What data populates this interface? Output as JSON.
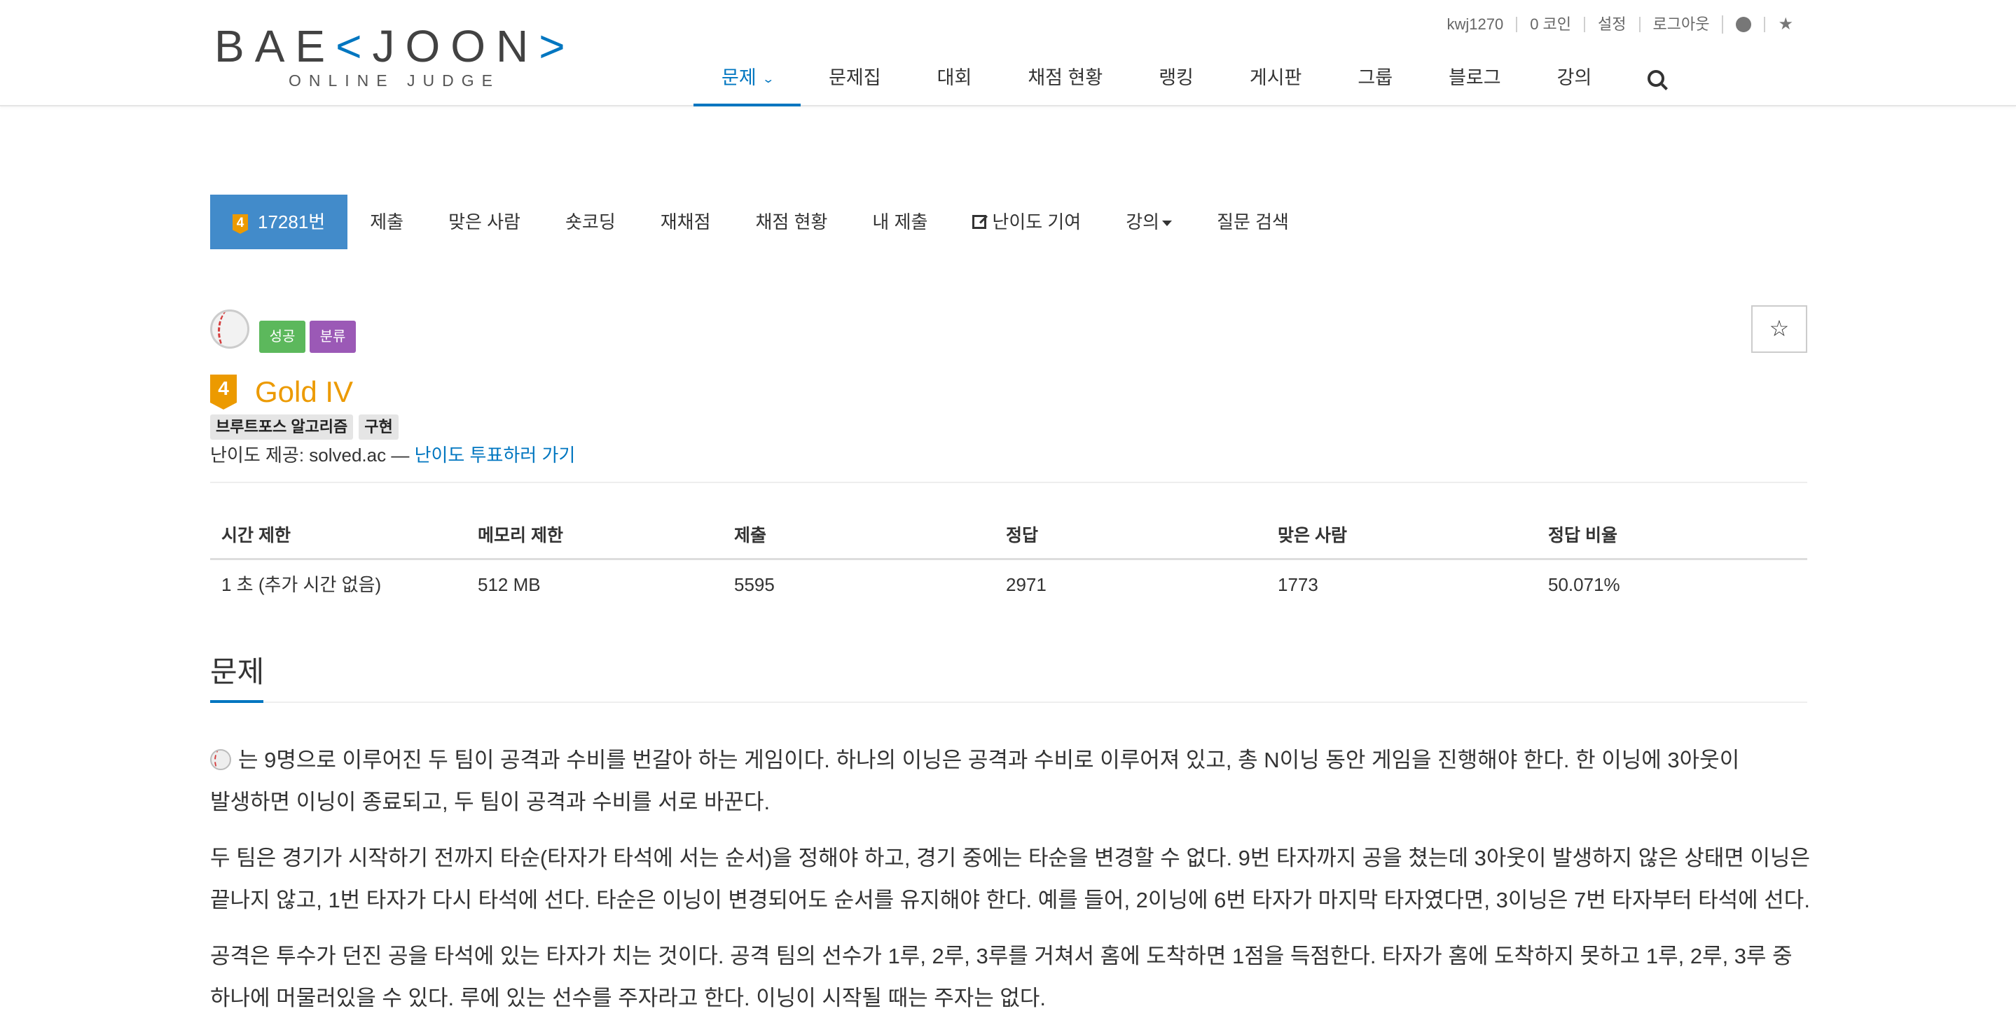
{
  "header": {
    "logo_main_left": "BAE",
    "logo_bracket_left": "<",
    "logo_main_right": "JOON",
    "logo_bracket_right": ">",
    "logo_sub": "ONLINE JUDGE",
    "top_menu": {
      "username": "kwj1270",
      "coins": "0 코인",
      "settings": "설정",
      "logout": "로그아웃"
    },
    "nav": {
      "problems": "문제",
      "workbook": "문제집",
      "contest": "대회",
      "status": "채점 현황",
      "ranking": "랭킹",
      "board": "게시판",
      "group": "그룹",
      "blog": "블로그",
      "lecture": "강의"
    }
  },
  "problem_menu": {
    "tier_digit": "4",
    "problem_number": "17281번",
    "submit": "제출",
    "accepted_users": "맞은 사람",
    "shortcoding": "숏코딩",
    "rejudge": "재채점",
    "status": "채점 현황",
    "my_submissions": "내 제출",
    "contribute_tier": "난이도 기여",
    "lecture": "강의",
    "question_search": "질문 검색"
  },
  "labels": {
    "success": "성공",
    "classification": "분류"
  },
  "fav_star": "☆",
  "tier": {
    "digit": "4",
    "name": "Gold IV",
    "color": "#ec9a00"
  },
  "tags": [
    "브루트포스 알고리즘",
    "구현"
  ],
  "tier_source": {
    "prefix": "난이도 제공: solved.ac — ",
    "link": "난이도 투표하러 가기"
  },
  "info_table": {
    "headers": [
      "시간 제한",
      "메모리 제한",
      "제출",
      "정답",
      "맞은 사람",
      "정답 비율"
    ],
    "values": [
      "1 초 (추가 시간 없음)",
      "512 MB",
      "5595",
      "2971",
      "1773",
      "50.071%"
    ]
  },
  "section": {
    "title": "문제"
  },
  "description": {
    "p1": "는 9명으로 이루어진 두 팀이 공격과 수비를 번갈아 하는 게임이다. 하나의 이닝은 공격과 수비로 이루어져 있고, 총 N이닝 동안 게임을 진행해야 한다. 한 이닝에 3아웃이 발생하면 이닝이 종료되고, 두 팀이 공격과 수비를 서로 바꾼다.",
    "p2": "두 팀은 경기가 시작하기 전까지 타순(타자가 타석에 서는 순서)을 정해야 하고, 경기 중에는 타순을 변경할 수 없다. 9번 타자까지 공을 쳤는데 3아웃이 발생하지 않은 상태면 이닝은 끝나지 않고, 1번 타자가 다시 타석에 선다. 타순은 이닝이 변경되어도 순서를 유지해야 한다. 예를 들어, 2이닝에 6번 타자가 마지막 타자였다면, 3이닝은 7번 타자부터 타석에 선다.",
    "p3": "공격은 투수가 던진 공을 타석에 있는 타자가 치는 것이다. 공격 팀의 선수가 1루, 2루, 3루를 거쳐서 홈에 도착하면 1점을 득점한다. 타자가 홈에 도착하지 못하고 1루, 2루, 3루 중 하나에 머물러있을 수 있다. 루에 있는 선수를 주자라고 한다. 이닝이 시작될 때는 주자는 없다."
  },
  "colors": {
    "accent": "#0076c0",
    "problem_tab_bg": "#428bca",
    "success": "#5cb85c",
    "classification": "#9b59b6",
    "gold": "#ec9a00"
  }
}
